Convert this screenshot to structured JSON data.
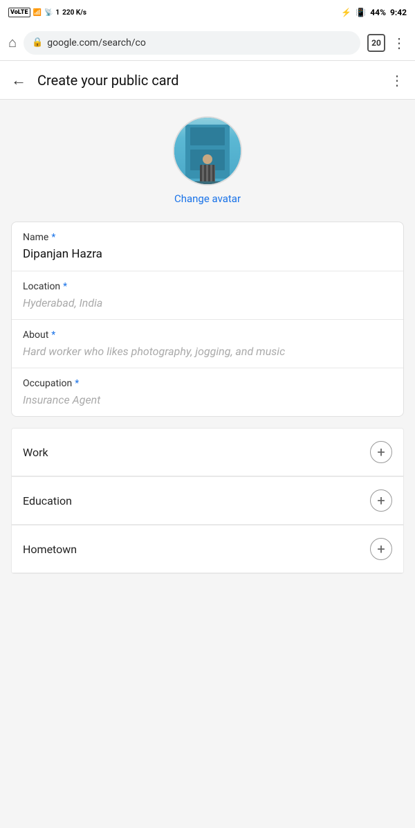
{
  "statusBar": {
    "carrier": "VoLTE",
    "network": "4G",
    "signal": "4G",
    "wifi": "WiFi",
    "simIndicator": "1",
    "dataSpeed": "220 K/s",
    "bluetooth": "BT",
    "vibrate": "vibrate",
    "battery": "44",
    "time": "9:42"
  },
  "browserBar": {
    "url": "google.com/search/co",
    "tabCount": "20"
  },
  "header": {
    "title": "Create your public card",
    "backLabel": "←",
    "menuLabel": "⋮"
  },
  "avatar": {
    "changeLabel": "Change avatar"
  },
  "form": {
    "fields": [
      {
        "label": "Name",
        "required": true,
        "value": "Dipanjan Hazra",
        "placeholder": "",
        "isPlaceholder": false
      },
      {
        "label": "Location",
        "required": true,
        "value": "Hyderabad, India",
        "placeholder": "Hyderabad, India",
        "isPlaceholder": true
      },
      {
        "label": "About",
        "required": true,
        "value": "Hard worker who likes photography, jogging, and music",
        "placeholder": "Hard worker who likes photography, jogging, and music",
        "isPlaceholder": true
      },
      {
        "label": "Occupation",
        "required": true,
        "value": "Insurance Agent",
        "placeholder": "Insurance Agent",
        "isPlaceholder": true
      }
    ]
  },
  "expandableSections": [
    {
      "label": "Work",
      "plusLabel": "+"
    },
    {
      "label": "Education",
      "plusLabel": "+"
    },
    {
      "label": "Hometown",
      "plusLabel": "+"
    }
  ]
}
